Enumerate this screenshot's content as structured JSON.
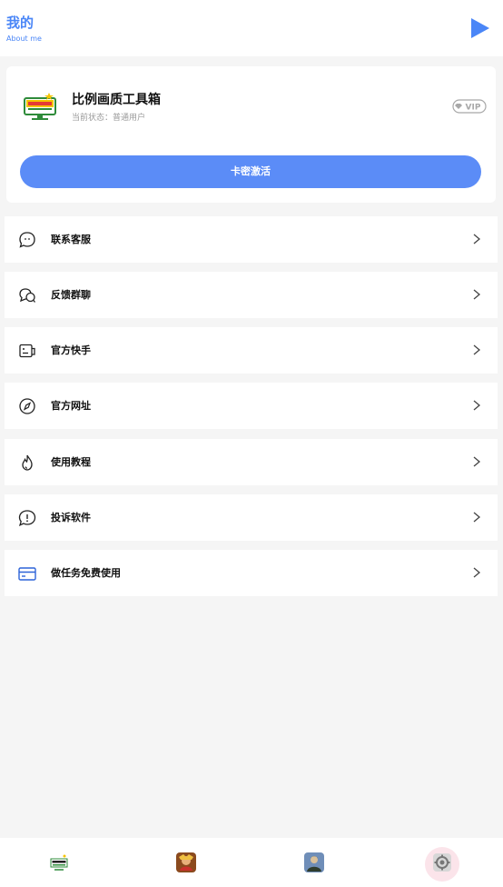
{
  "header": {
    "title": "我的",
    "subtitle": "About me",
    "accent_color": "#4a86f7",
    "play_icon": "play-triangle-icon"
  },
  "profile_card": {
    "app_name": "比例画质工具箱",
    "status": "当前状态：普通用户",
    "vip_badge_text": "VIP",
    "activate_button": "卡密激活",
    "button_color": "#5b8cf7"
  },
  "menu": {
    "items": [
      {
        "label": "联系客服",
        "icon": "chat-bubble-icon"
      },
      {
        "label": "反馈群聊",
        "icon": "group-chat-icon"
      },
      {
        "label": "官方快手",
        "icon": "id-card-icon"
      },
      {
        "label": "官方网址",
        "icon": "compass-icon"
      },
      {
        "label": "使用教程",
        "icon": "flame-icon"
      },
      {
        "label": "投诉软件",
        "icon": "alert-bubble-icon"
      },
      {
        "label": "做任务免费使用",
        "icon": "credit-card-icon"
      }
    ]
  },
  "tabbar": {
    "tabs": [
      {
        "icon": "app-logo-tab-icon"
      },
      {
        "icon": "game-character-tab-icon"
      },
      {
        "icon": "pubg-tab-icon"
      },
      {
        "icon": "settings-gear-tab-icon",
        "active": true
      }
    ]
  }
}
